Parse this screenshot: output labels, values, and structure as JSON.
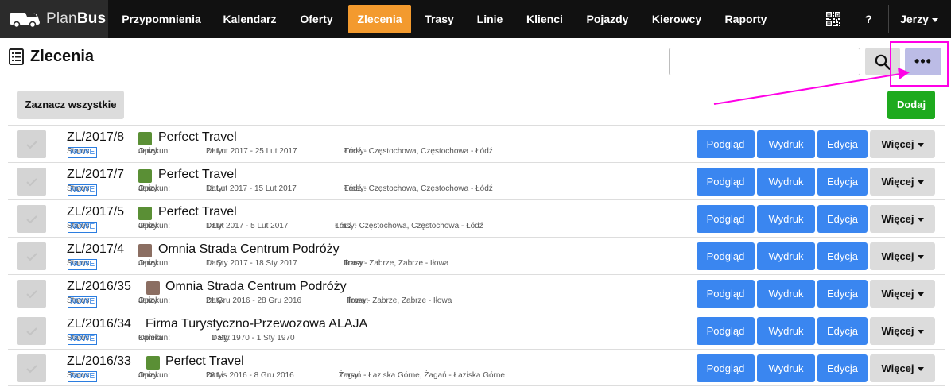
{
  "nav": {
    "logo_plan": "Plan",
    "logo_bus": "Bus",
    "items": [
      {
        "label": "Przypomnienia",
        "active": false
      },
      {
        "label": "Kalendarz",
        "active": false
      },
      {
        "label": "Oferty",
        "active": false
      },
      {
        "label": "Zlecenia",
        "active": true
      },
      {
        "label": "Trasy",
        "active": false
      },
      {
        "label": "Linie",
        "active": false
      },
      {
        "label": "Klienci",
        "active": false
      },
      {
        "label": "Pojazdy",
        "active": false
      },
      {
        "label": "Kierowcy",
        "active": false
      },
      {
        "label": "Raporty",
        "active": false
      }
    ],
    "help": "?",
    "user": "Jerzy",
    "accent": "#f39a2e"
  },
  "header": {
    "title": "Zlecenia",
    "search_value": "",
    "more_label": "•••",
    "select_all": "Zaznacz wszystkie",
    "add": "Dodaj"
  },
  "labels": {
    "status": "Status:",
    "opiekun": "Opiekun:",
    "daty": "Daty:",
    "trasy": "Trasy:",
    "podglad": "Podgląd",
    "wydruk": "Wydruk",
    "edycja": "Edycja",
    "wiecej": "Więcej"
  },
  "orders": [
    {
      "id": "ZL/2017/8",
      "client": "Perfect Travel",
      "color": "#5a8f35",
      "status": "NOWE",
      "opiekun": "Jerzy",
      "daty": "21 Lut 2017 - 25 Lut 2017",
      "trasy": "Łódź - Częstochowa, Częstochowa - Łódź"
    },
    {
      "id": "ZL/2017/7",
      "client": "Perfect Travel",
      "color": "#5a8f35",
      "status": "NOWE",
      "opiekun": "Jerzy",
      "daty": "11 Lut 2017 - 15 Lut 2017",
      "trasy": "Łódź - Częstochowa, Częstochowa - Łódź"
    },
    {
      "id": "ZL/2017/5",
      "client": "Perfect Travel",
      "color": "#5a8f35",
      "status": "NOWE",
      "opiekun": "Jerzy",
      "daty": "1 Lut 2017 - 5 Lut 2017",
      "trasy": "Łódź - Częstochowa, Częstochowa - Łódź"
    },
    {
      "id": "ZL/2017/4",
      "client": "Omnia Strada Centrum Podróży",
      "color": "#8b6e62",
      "status": "NOWE",
      "opiekun": "Jerzy",
      "daty": "11 Sty 2017 - 18 Sty 2017",
      "trasy": "Iłowa - Zabrze, Zabrze - Iłowa"
    },
    {
      "id": "ZL/2016/35",
      "client": "Omnia Strada Centrum Podróży",
      "color": "#8b6e62",
      "status": "NOWE",
      "opiekun": "Jerzy",
      "daty": "21 Gru 2016 - 28 Gru 2016",
      "trasy": "Iłowa - Zabrze, Zabrze - Iłowa"
    },
    {
      "id": "ZL/2016/34",
      "client": "Firma Turystyczno-Przewozowa ALAJA",
      "color": null,
      "status": "NOWE",
      "opiekun": "Kamila",
      "daty": "1 Sty 1970 - 1 Sty 1970",
      "trasy": null
    },
    {
      "id": "ZL/2016/33",
      "client": "Perfect Travel",
      "color": "#5a8f35",
      "status": "NOWE",
      "opiekun": "Jerzy",
      "daty": "28 Lis 2016 - 8 Gru 2016",
      "trasy": "Żagań - Łaziska Górne, Żagań - Łaziska Górne"
    }
  ]
}
